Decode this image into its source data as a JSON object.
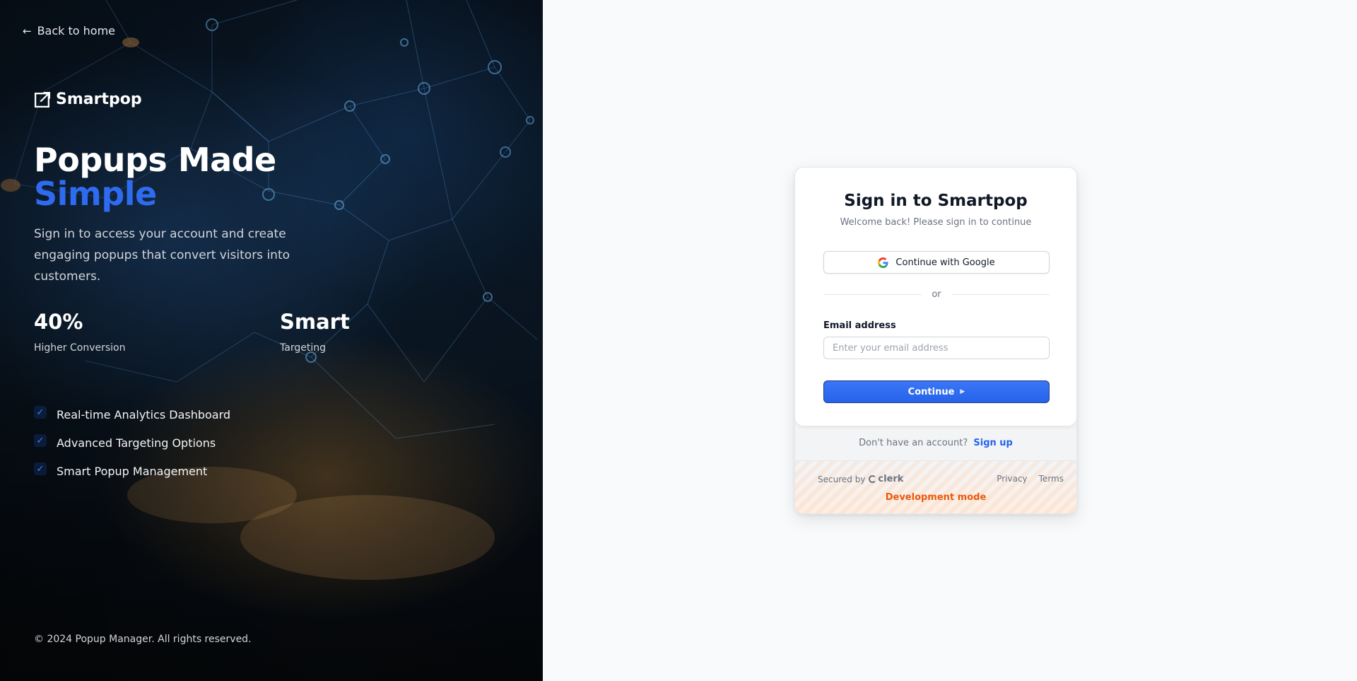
{
  "hero": {
    "back_link": "Back to home",
    "brand": "Smartpop",
    "headline_line1": "Popups Made",
    "headline_accent": "Simple",
    "subtitle": "Sign in to access your account and create engaging popups that convert visitors into customers.",
    "stats": [
      {
        "value": "40%",
        "label": "Higher Conversion"
      },
      {
        "value": "Smart",
        "label": "Targeting"
      }
    ],
    "features": [
      "Real-time Analytics Dashboard",
      "Advanced Targeting Options",
      "Smart Popup Management"
    ],
    "check_glyph": "✓",
    "copyright": "© 2024 Popup Manager. All rights reserved."
  },
  "signin": {
    "title": "Sign in to Smartpop",
    "subtitle": "Welcome back! Please sign in to continue",
    "google_label": "Continue with Google",
    "divider": "or",
    "email_label": "Email address",
    "email_value": "",
    "email_placeholder": "Enter your email address",
    "continue_label": "Continue",
    "no_account_text": "Don't have an account?",
    "signup_link": "Sign up",
    "secured_by": "Secured by",
    "clerk_brand": "clerk",
    "privacy": "Privacy",
    "terms": "Terms",
    "dev_mode": "Development mode"
  },
  "colors": {
    "accent": "#2f6bf0",
    "primary_button": "#2563eb",
    "dev_mode": "#ea580c",
    "page_bg": "#f9fafb"
  },
  "icons": {
    "back": "arrow-left-icon",
    "brand": "external-link-square-icon",
    "google": "google-g-icon",
    "check": "check-icon",
    "continue": "caret-right-icon",
    "clerk": "clerk-logo-icon"
  }
}
